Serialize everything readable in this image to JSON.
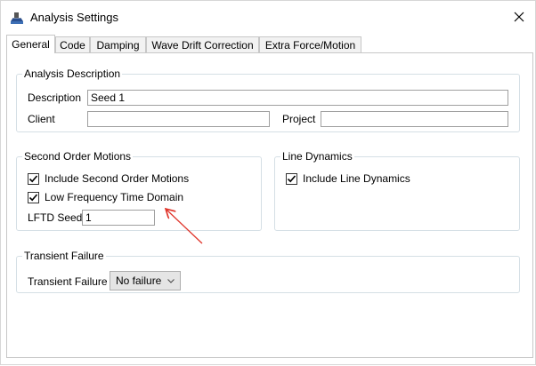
{
  "window": {
    "title": "Analysis Settings"
  },
  "tabs": [
    {
      "label": "General"
    },
    {
      "label": "Code"
    },
    {
      "label": "Damping"
    },
    {
      "label": "Wave Drift Correction"
    },
    {
      "label": "Extra Force/Motion"
    }
  ],
  "analysis_description": {
    "legend": "Analysis Description",
    "description_label": "Description",
    "description_value": "Seed 1",
    "client_label": "Client",
    "client_value": "",
    "project_label": "Project",
    "project_value": ""
  },
  "second_order": {
    "legend": "Second Order Motions",
    "include_label": "Include Second Order Motions",
    "include_checked": true,
    "lftd_label": "Low Frequency Time Domain",
    "lftd_checked": true,
    "seed_label": "LFTD Seed",
    "seed_value": "1"
  },
  "line_dynamics": {
    "legend": "Line Dynamics",
    "include_label": "Include Line Dynamics",
    "include_checked": true
  },
  "transient": {
    "legend": "Transient Failure",
    "label": "Transient Failure",
    "selected": "No failure"
  },
  "colors": {
    "annotation_arrow": "#e0352b",
    "group_border": "#d5dfe5"
  }
}
